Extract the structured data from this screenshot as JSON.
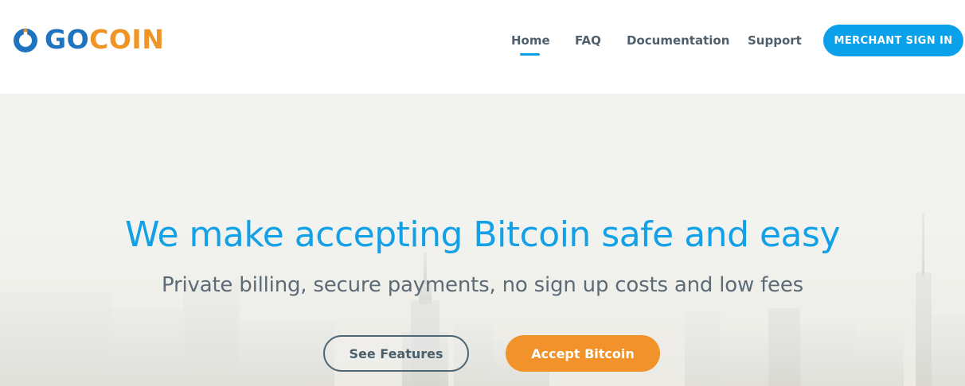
{
  "brand": {
    "logo_icon": "power-flame-icon",
    "name_part1": "GO",
    "name_part2": "COIN",
    "color_primary": "#1f74bf",
    "color_accent": "#f19426"
  },
  "nav": {
    "items": [
      {
        "label": "Home",
        "active": true
      },
      {
        "label": "FAQ",
        "active": false
      },
      {
        "label": "Documentation",
        "active": false
      },
      {
        "label": "Support",
        "active": false
      }
    ],
    "signin_label": "MERCHANT SIGN IN"
  },
  "hero": {
    "title": "We make accepting Bitcoin safe and easy",
    "subtitle": "Private billing, secure payments, no sign up costs and low fees",
    "secondary_button": "See Features",
    "primary_button": "Accept Bitcoin",
    "title_color": "#12a1e6",
    "primary_button_color": "#f2922a",
    "signin_color": "#0aa1ea"
  }
}
